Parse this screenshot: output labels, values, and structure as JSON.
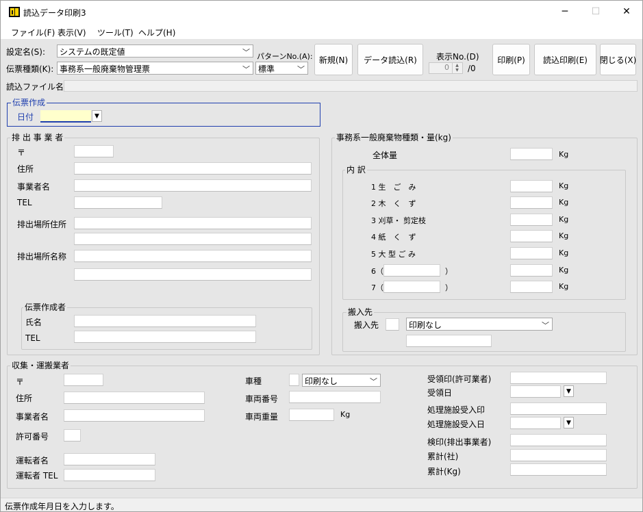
{
  "window": {
    "title": "読込データ印刷3",
    "minimize_glyph": "─",
    "maximize_glyph": "☐",
    "close_glyph": "✕"
  },
  "menu": [
    "ファイル(F)",
    "表示(V)",
    "ツール(T)",
    "ヘルプ(H)"
  ],
  "toolbar": {
    "setting_label": "設定名(S):",
    "setting_value": "システムの既定値",
    "slip_type_label": "伝票種類(K):",
    "slip_type_value": "事務系一般廃棄物管理票",
    "pattern_label": "パターンNo.(A):",
    "pattern_value": "標準",
    "new_button": "新規(N)",
    "data_read_button": "データ読込(R)",
    "display_no_label": "表示No.(D)",
    "display_no_value": "0",
    "display_no_total": "/0",
    "print_button": "印刷(P)",
    "read_print_button": "読込印刷(E)",
    "close_button": "閉じる(X)",
    "read_file_label": "読込ファイル名"
  },
  "slip_creation": {
    "title": "伝票作成",
    "date_label": "日付"
  },
  "discharger": {
    "title": "排 出 事 業 者",
    "postal_label": "〒",
    "address_label": "住所",
    "business_name_label": "事業者名",
    "tel_label": "TEL",
    "site_address_label": "排出場所住所",
    "site_name_label": "排出場所名称",
    "creator": {
      "title": "伝票作成者",
      "name_label": "氏名",
      "tel_label": "TEL"
    }
  },
  "waste": {
    "title": "事務系一般廃棄物種類・量(kg)",
    "total_label": "全体量",
    "unit": "Kg",
    "breakdown_title": "内 訳",
    "items": [
      "1 生　ご　み",
      "2 木　く　ず",
      "3 刈草・ 剪定枝",
      "4 紙　く　ず",
      "5 大 型 ご み",
      "6（",
      "7（"
    ],
    "close_paren": "）",
    "delivery": {
      "title": "搬入先",
      "label": "搬入先",
      "print_value": "印刷なし"
    }
  },
  "collector": {
    "title": "収集・運搬業者",
    "postal_label": "〒",
    "address_label": "住所",
    "business_name_label": "事業者名",
    "permit_label": "許可番号",
    "driver_label": "運転者名",
    "driver_tel_label": "運転者 TEL",
    "vehicle_type_label": "車種",
    "vehicle_type_value": "印刷なし",
    "vehicle_no_label": "車両番号",
    "vehicle_weight_label": "車両重量",
    "unit": "Kg",
    "receipt_seal_label": "受領印(許可業者)",
    "receipt_date_label": "受領日",
    "facility_seal_label": "処理施設受入印",
    "facility_date_label": "処理施設受入日",
    "inspection_seal_label": "検印(排出事業者)",
    "cumulative_company_label": "累計(社)",
    "cumulative_kg_label": "累計(Kg)"
  },
  "status": {
    "text": "伝票作成年月日を入力します。"
  }
}
